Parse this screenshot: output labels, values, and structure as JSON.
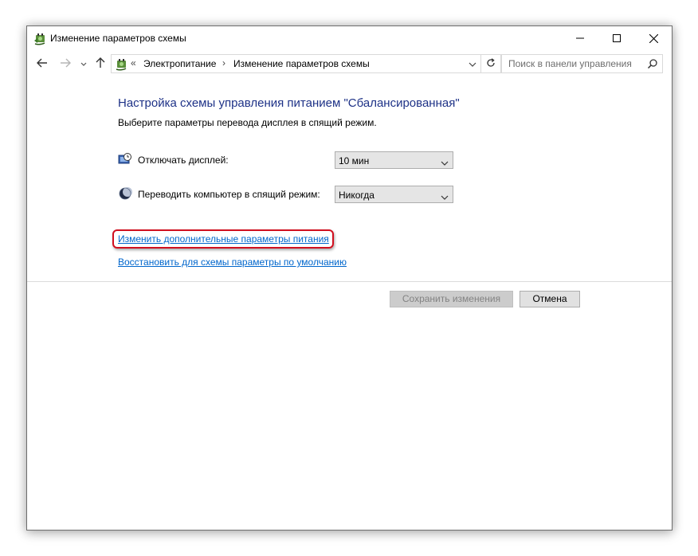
{
  "window": {
    "title": "Изменение параметров схемы"
  },
  "icons": {
    "app": "power-options-icon",
    "minimize": "minimize-icon",
    "maximize": "maximize-icon",
    "close": "close-icon",
    "back": "arrow-left-icon",
    "forward": "arrow-right-icon",
    "recent": "chevron-down-icon",
    "up": "arrow-up-icon",
    "refresh": "refresh-icon",
    "search": "search-icon",
    "display": "display-clock-icon",
    "sleep": "moon-icon"
  },
  "address": {
    "overflow": "«",
    "crumbs": [
      "Электропитание",
      "Изменение параметров схемы"
    ],
    "separator": "›"
  },
  "search": {
    "placeholder": "Поиск в панели управления"
  },
  "content": {
    "heading": "Настройка схемы управления питанием \"Сбалансированная\"",
    "subheading": "Выберите параметры перевода дисплея в спящий режим.",
    "settings": [
      {
        "label": "Отключать дисплей:",
        "value": "10 мин"
      },
      {
        "label": "Переводить компьютер в спящий режим:",
        "value": "Никогда"
      }
    ],
    "links": [
      "Изменить дополнительные параметры питания",
      "Восстановить для схемы параметры по умолчанию"
    ]
  },
  "buttons": {
    "save": "Сохранить изменения",
    "cancel": "Отмена"
  },
  "colors": {
    "heading": "#1e3287",
    "link": "#0066cc",
    "highlight": "#d10f1f"
  }
}
